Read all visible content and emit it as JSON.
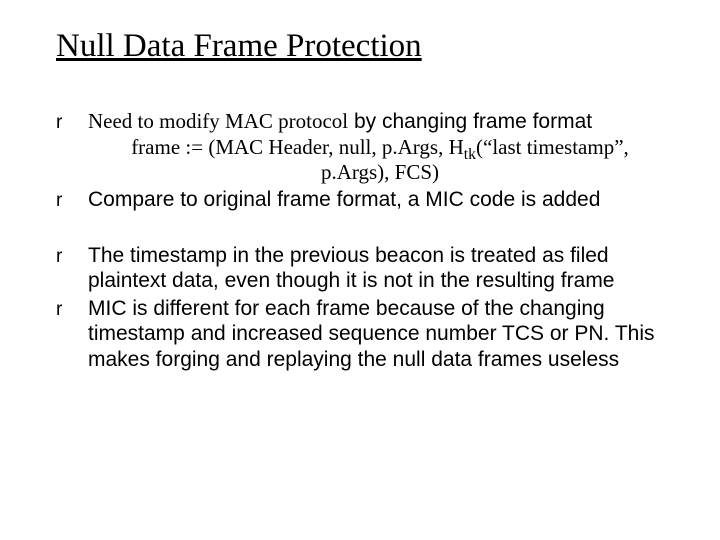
{
  "title": "Null Data Frame Protection",
  "bullet_marker": "r",
  "group1": {
    "item1_a": "Need to modify MAC protocol",
    "item1_b": "by changing frame format",
    "frame_def_line1_pre": "frame := (MAC Header, null, p.Args, H",
    "frame_def_sub": "tk",
    "frame_def_line1_post": "(“last timestamp”,",
    "frame_def_line2": "p.Args), FCS)",
    "item2": "Compare to original frame format, a MIC code is added"
  },
  "group2": {
    "item1": "The timestamp in the previous beacon is treated as filed plaintext data, even though it is not in the resulting frame",
    "item2": "MIC is different for each frame because of the changing timestamp and increased sequence number TCS or PN. This makes forging and replaying the null data frames useless"
  }
}
